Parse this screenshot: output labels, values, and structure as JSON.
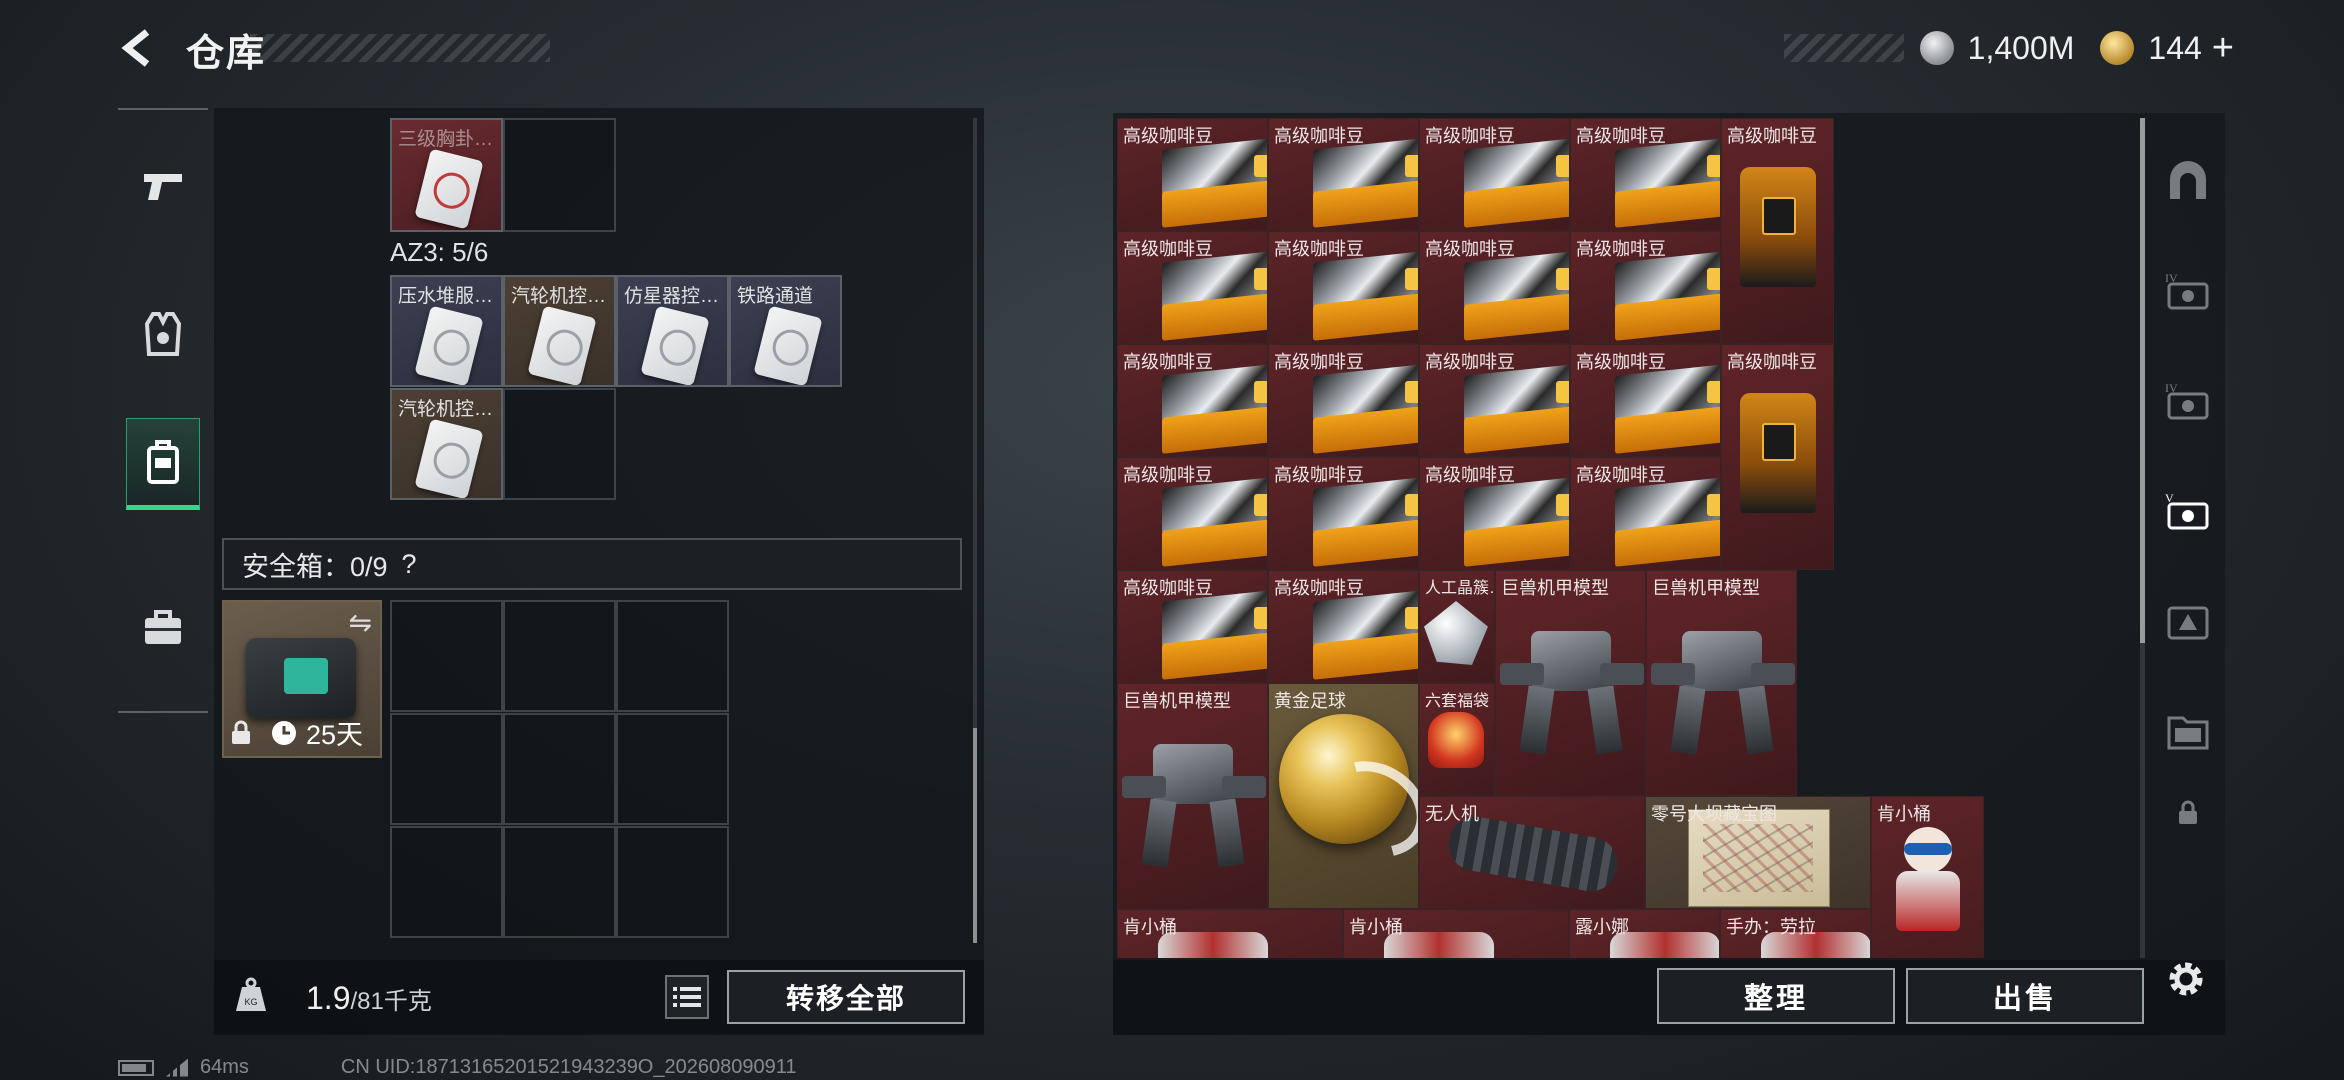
{
  "header": {
    "title": "仓库"
  },
  "currency": {
    "silver": "1,400M",
    "gold": "144",
    "plus": "+"
  },
  "left_nav": [
    {
      "icon": "pistol-icon"
    },
    {
      "icon": "vest-icon"
    },
    {
      "icon": "backpack-icon",
      "active": true
    },
    {
      "icon": "briefcase-icon"
    }
  ],
  "container": {
    "top_slots": [
      {
        "label": "三级胸卦…",
        "style": "red"
      }
    ],
    "az3_label": "AZ3: 5/6",
    "az3_items": [
      {
        "label": "压水堆服…"
      },
      {
        "label": "汽轮机控…"
      },
      {
        "label": "仿星器控…"
      },
      {
        "label": "铁路通道"
      },
      {
        "label": "汽轮机控…"
      }
    ]
  },
  "safe_box": {
    "label": "安全箱：0/9",
    "help": "?",
    "days": "25天"
  },
  "left_footer": {
    "weight_current": "1.9",
    "weight_max": "/81千克",
    "transfer_label": "转移全部"
  },
  "stash_items": [
    {
      "label": "高级咖啡豆",
      "kind": "coffee"
    },
    {
      "label": "高级咖啡豆",
      "kind": "coffee"
    },
    {
      "label": "高级咖啡豆",
      "kind": "coffee"
    },
    {
      "label": "高级咖啡豆",
      "kind": "coffee"
    },
    {
      "label": "高级咖啡豆",
      "kind": "coffee-tall"
    },
    {
      "label": "高级咖啡豆",
      "kind": "coffee"
    },
    {
      "label": "高级咖啡豆",
      "kind": "coffee"
    },
    {
      "label": "高级咖啡豆",
      "kind": "coffee"
    },
    {
      "label": "高级咖啡豆",
      "kind": "coffee"
    },
    {
      "label": "高级咖啡豆",
      "kind": "coffee"
    },
    {
      "label": "高级咖啡豆",
      "kind": "coffee"
    },
    {
      "label": "高级咖啡豆",
      "kind": "coffee"
    },
    {
      "label": "高级咖啡豆",
      "kind": "coffee"
    },
    {
      "label": "高级咖啡豆",
      "kind": "coffee-tall"
    },
    {
      "label": "高级咖啡豆",
      "kind": "coffee"
    },
    {
      "label": "高级咖啡豆",
      "kind": "coffee"
    },
    {
      "label": "高级咖啡豆",
      "kind": "coffee"
    },
    {
      "label": "高级咖啡豆",
      "kind": "coffee"
    },
    {
      "label": "高级咖啡豆",
      "kind": "coffee"
    },
    {
      "label": "高级咖啡豆",
      "kind": "coffee"
    },
    {
      "label": "人工晶簇…",
      "kind": "crystal"
    },
    {
      "label": "巨兽机甲模型",
      "kind": "mech"
    },
    {
      "label": "巨兽机甲模型",
      "kind": "mech"
    },
    {
      "label": "巨兽机甲模型",
      "kind": "mech"
    },
    {
      "label": "黄金足球",
      "kind": "ball"
    },
    {
      "label": "六套福袋",
      "kind": "lucky-bag"
    },
    {
      "label": "无人机",
      "kind": "drone"
    },
    {
      "label": "零号大坝藏宝图",
      "kind": "map"
    },
    {
      "label": "肯小桶",
      "kind": "figure"
    },
    {
      "label": "肯小桶",
      "kind": "figure-small"
    },
    {
      "label": "肯小桶",
      "kind": "figure-small"
    },
    {
      "label": "露小娜",
      "kind": "figure-small"
    },
    {
      "label": "手办：劳拉",
      "kind": "figure-small"
    }
  ],
  "right_footer": {
    "sort_label": "整理",
    "sell_label": "出售"
  },
  "right_tabs": [
    {
      "icon": "arch-icon"
    },
    {
      "icon": "armor-iv-icon"
    },
    {
      "icon": "armor-iv-icon"
    },
    {
      "icon": "armor-v-icon",
      "active": true
    },
    {
      "icon": "triangle-case-icon"
    },
    {
      "icon": "folder-icon"
    },
    {
      "icon": "lock-icon"
    }
  ],
  "status_bar": {
    "ping": "64ms",
    "uid": "CN UID:18713165201521943239O_202608090911"
  }
}
